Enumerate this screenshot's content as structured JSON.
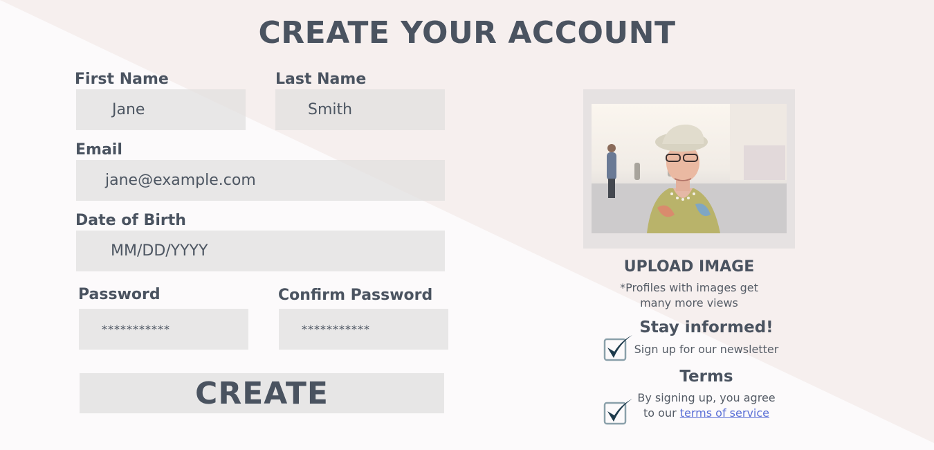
{
  "page": {
    "title": "CREATE YOUR ACCOUNT"
  },
  "form": {
    "first_name": {
      "label": "First Name",
      "value": "Jane"
    },
    "last_name": {
      "label": "Last Name",
      "value": "Smith"
    },
    "email": {
      "label": "Email",
      "value": "jane@example.com"
    },
    "dob": {
      "label": "Date of Birth",
      "placeholder": "MM/DD/YYYY"
    },
    "password": {
      "label": "Password",
      "value": "***********"
    },
    "confirm_password": {
      "label": "Confirm Password",
      "value": "***********"
    },
    "submit_label": "CREATE"
  },
  "upload": {
    "title": "UPLOAD IMAGE",
    "note_line1": "*Profiles with images get",
    "note_line2": "many more views"
  },
  "newsletter": {
    "heading": "Stay informed!",
    "text": "Sign up for our newsletter",
    "checked": true
  },
  "terms": {
    "heading": "Terms",
    "line1": "By signing up, you agree",
    "line2_prefix": "to our ",
    "link_text": "terms of service",
    "checked": true
  },
  "colors": {
    "text": "#4a5360",
    "field_bg": "#e1dfdf",
    "accent_triangle": "#f5eeed",
    "check": "#1e3b4c",
    "link": "#5a6fd6"
  },
  "icons": {
    "check": "check-icon"
  }
}
